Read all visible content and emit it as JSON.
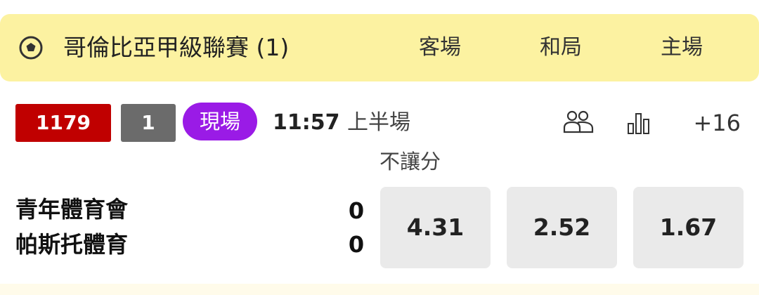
{
  "league": {
    "title": "哥倫比亞甲級聯賽 (1)",
    "icon": "soccer-ball-icon",
    "header_bg": "#fcf2a1"
  },
  "columns": {
    "away": "客場",
    "draw": "和局",
    "home": "主場"
  },
  "match": {
    "id": "1179",
    "number": "1",
    "live_label": "現場",
    "time": "11:57",
    "period": "上半場",
    "more_markets": "+16",
    "market_label": "不讓分",
    "home_team": "青年體育會",
    "away_team": "帕斯托體育",
    "home_score": "0",
    "away_score": "0"
  },
  "odds": {
    "away": "4.31",
    "draw": "2.52",
    "home": "1.67"
  },
  "colors": {
    "id_badge": "#c00000",
    "number_badge": "#6b6b6b",
    "live_badge": "#9a1be6",
    "odds_bg": "#eaeaea"
  },
  "icons": {
    "lineup": "lineup-icon",
    "stats": "stats-icon"
  }
}
